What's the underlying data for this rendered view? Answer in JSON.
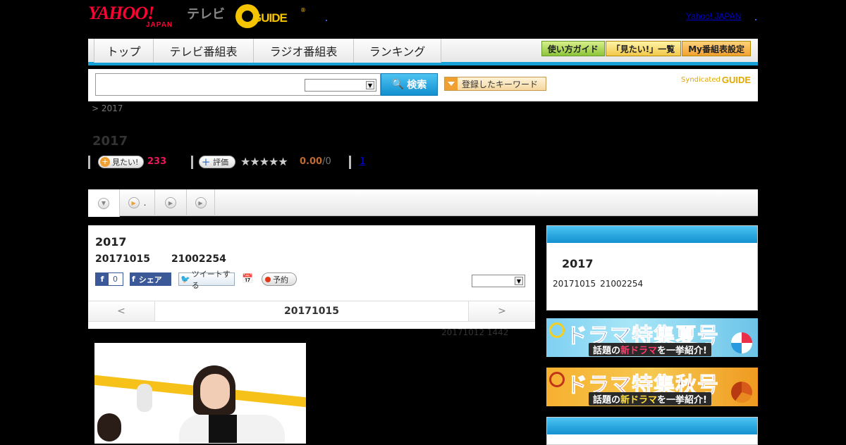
{
  "header": {
    "yahoo_logo": "YAHOO!",
    "yahoo_sub": "JAPAN",
    "tv_label": "テレビ",
    "gguide_logo": "GUIDE",
    "gguide_reg": "®",
    "yahoo_japan_link": "Yahoo! JAPAN"
  },
  "nav": {
    "tabs": [
      "トップ",
      "テレビ番組表",
      "ラジオ番組表",
      "ランキング"
    ],
    "buttons": [
      "使い方ガイド",
      "「見たい!」一覧",
      "My番組表設定"
    ]
  },
  "search": {
    "button_label": "検索",
    "keyword_button": "登録したキーワード",
    "syndicated": "Syndicated",
    "syndicated_logo": "GUIDE"
  },
  "breadcrumb": ">  2017",
  "page_title": "2017",
  "stats": {
    "want_label": "見たい!",
    "want_count": "233",
    "rate_label": "評価",
    "stars": "★★★★★",
    "score": "0.00",
    "score_den": "/0",
    "review_link": "1"
  },
  "tabs": [
    {
      "icon": "chevron-down-icon",
      "label": ""
    },
    {
      "icon": "play-icon",
      "label": "."
    },
    {
      "icon": "play-icon",
      "label": ""
    },
    {
      "icon": "play-icon",
      "label": ""
    }
  ],
  "program": {
    "title": "2017",
    "date": "20171015",
    "time": "21002254",
    "social": {
      "fb_count": "0",
      "fb_share": "シェア",
      "tweet": "ツイートする",
      "reserve": "予約"
    },
    "pager": {
      "prev": "<",
      "current": "20171015",
      "next": ">"
    },
    "meta": "20171012  1442"
  },
  "sidebar": {
    "card_title": "2017",
    "card_date": "20171015",
    "card_time": "21002254",
    "banner_summer": {
      "title": "ドラマ特集夏号",
      "sub_a": "話題の",
      "sub_hl": "新ドラマ",
      "sub_b": "を一挙紹介!"
    },
    "banner_autumn": {
      "title": "ドラマ特集秋号",
      "sub_a": "話題の",
      "sub_hl": "新ドラマ",
      "sub_b": "を一挙紹介!"
    }
  },
  "colors": {
    "accent_blue": "#16a0d6",
    "want_count": "#e8195a",
    "score": "#c06a30",
    "link": "#0000cc"
  }
}
